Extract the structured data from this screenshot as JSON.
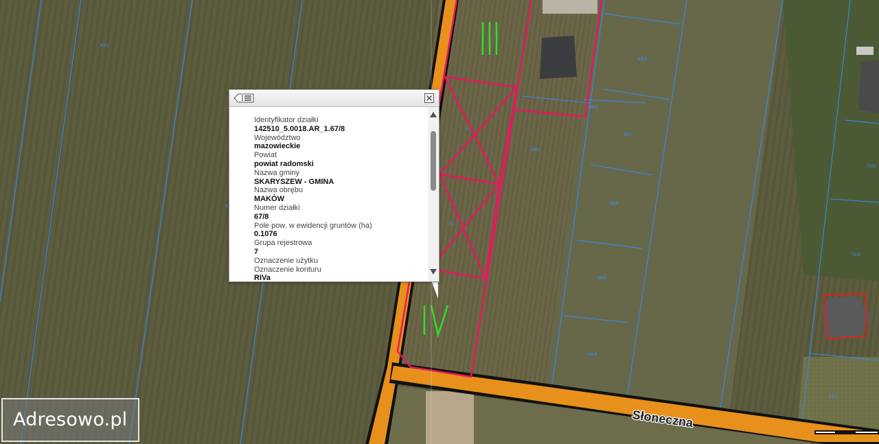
{
  "popup": {
    "fields": [
      {
        "label": "Identyfikator działki",
        "value": "142510_5.0018.AR_1.67/8"
      },
      {
        "label": "Województwo",
        "value": "mazowieckie"
      },
      {
        "label": "Powiat",
        "value": "powiat radomski"
      },
      {
        "label": "Nazwa gminy",
        "value": "SKARYSZEW - GMINA"
      },
      {
        "label": "Nazwa obrębu",
        "value": "MAKÓW"
      },
      {
        "label": "Numer działki",
        "value": "67/8"
      },
      {
        "label": "Pole pow. w ewidencji gruntów (ha)",
        "value": "0.1076"
      },
      {
        "label": "Grupa rejestrowa",
        "value": "7"
      },
      {
        "label": "Oznaczenie użytku",
        "value": ""
      },
      {
        "label": "Oznaczenie konturu",
        "value": "RIVa"
      }
    ],
    "list_icon": "list-icon",
    "close_icon": "close-icon"
  },
  "map": {
    "street_name": "Słoneczna",
    "soil_class_labels": [
      "III",
      "IV"
    ],
    "colors": {
      "road": "#e8901c",
      "parcel_highlight": "#e8185c",
      "parcel_lines": "#2f8cff",
      "soil_class": "#2ee02e",
      "building_outline": "#e02020"
    }
  },
  "brand": {
    "logo_text": "Adresowo.pl"
  }
}
